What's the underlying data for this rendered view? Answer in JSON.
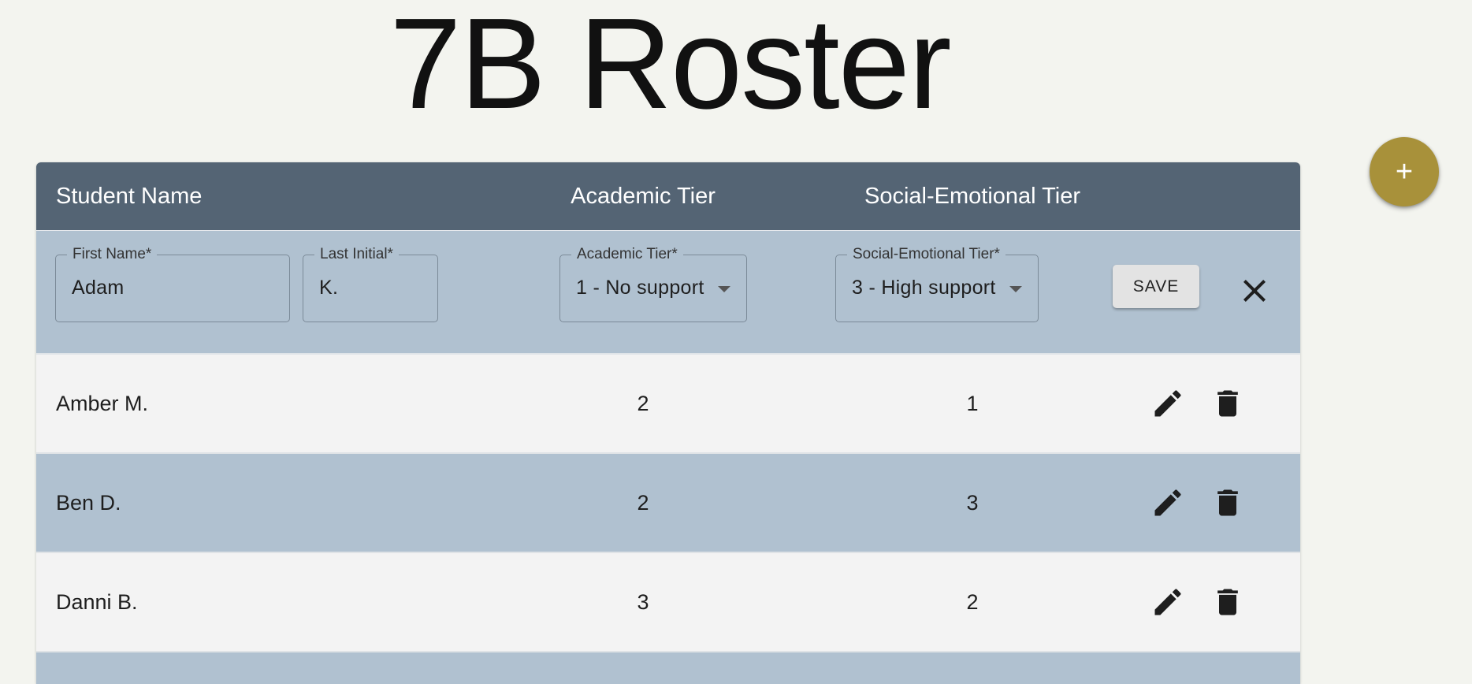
{
  "page": {
    "title": "7B Roster"
  },
  "fab": {
    "label": "+",
    "icon": "plus-icon",
    "color": "#a8913a"
  },
  "table": {
    "columns": {
      "student_name": "Student Name",
      "academic_tier": "Academic Tier",
      "social_emotional_tier": "Social-Emotional Tier"
    },
    "edit_row": {
      "first_name": {
        "label": "First Name*",
        "value": "Adam"
      },
      "last_initial": {
        "label": "Last Initial*",
        "value": "K."
      },
      "academic_tier": {
        "label": "Academic Tier*",
        "value": "1 - No support"
      },
      "social_emotional_tier": {
        "label": "Social-Emotional Tier*",
        "value": "3 - High support"
      },
      "save_label": "SAVE",
      "cancel_icon": "close-icon"
    },
    "rows": [
      {
        "name": "Amber M.",
        "academic": "2",
        "social_emotional": "1"
      },
      {
        "name": "Ben D.",
        "academic": "2",
        "social_emotional": "3"
      },
      {
        "name": "Danni B.",
        "academic": "3",
        "social_emotional": "2"
      }
    ],
    "row_actions": {
      "edit_icon": "pencil-icon",
      "delete_icon": "trash-icon"
    }
  },
  "colors": {
    "background": "#f3f4ef",
    "header": "#546474",
    "row_alt": "#b0c1d0",
    "row_light": "#f3f3f3"
  }
}
